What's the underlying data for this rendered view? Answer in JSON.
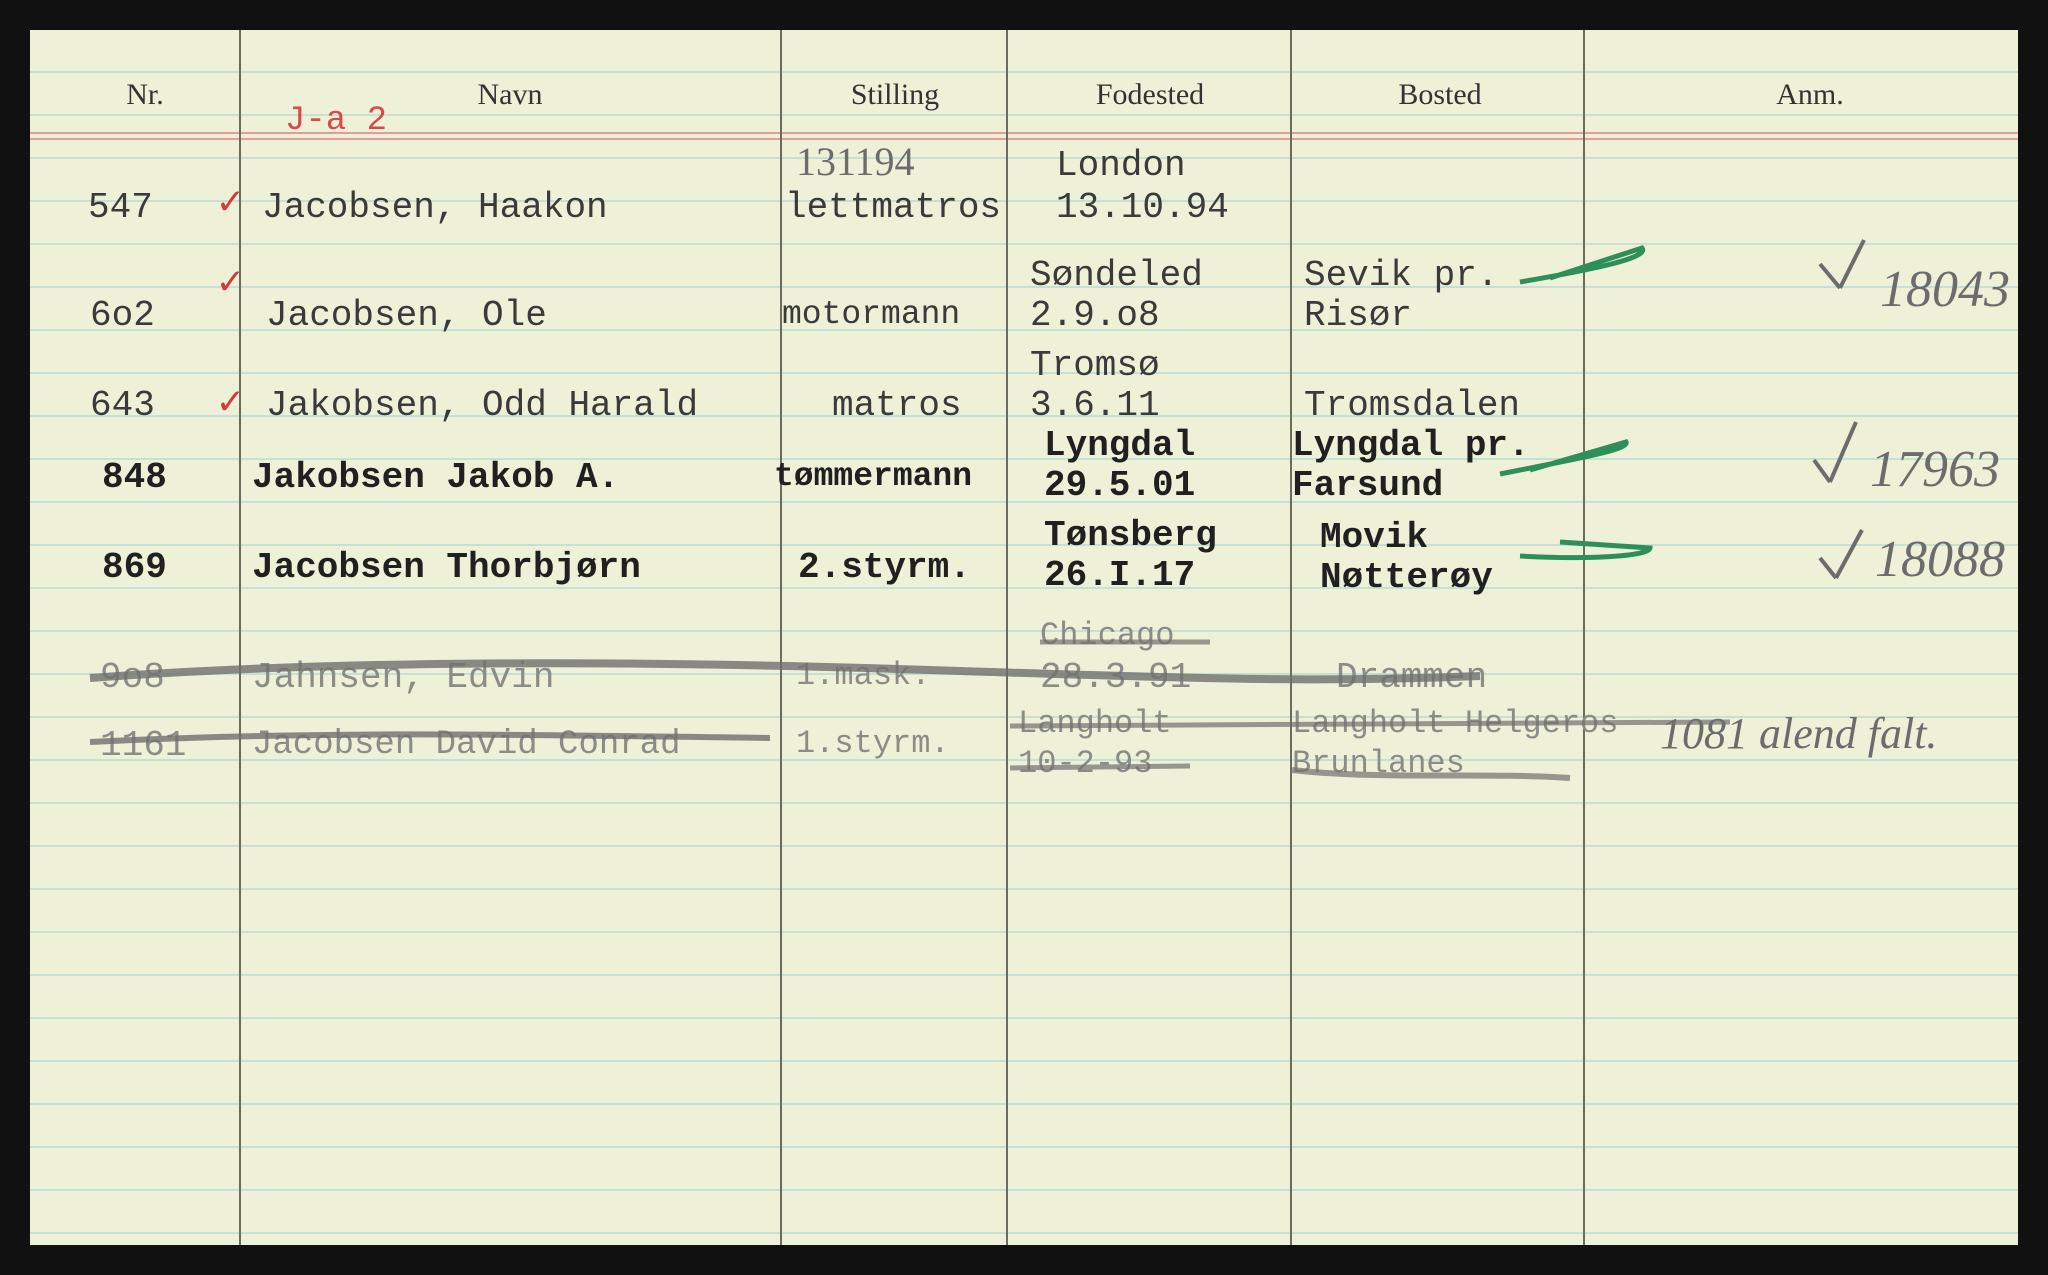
{
  "headers": [
    "Nr.",
    "Navn",
    "Stilling",
    "Fodested",
    "Bosted",
    "Anm."
  ],
  "card_code": "J-a 2",
  "rows": [
    {
      "nr": "547",
      "navn": "Jacobsen, Haakon",
      "stilling": "lettmatros",
      "fodested1": "London",
      "fodested2": "13.10.94",
      "bosted1": "",
      "bosted2": "",
      "note_above": "131194",
      "anm": ""
    },
    {
      "nr": "6o2",
      "navn": "Jacobsen, Ole",
      "stilling": "motormann",
      "fodested1": "Søndeled",
      "fodested2": "2.9.o8",
      "bosted1": "Sevik pr.",
      "bosted2": "Risør",
      "anm": "18043"
    },
    {
      "nr": "643",
      "navn": "Jakobsen, Odd Harald",
      "stilling": "matros",
      "fodested1": "Tromsø",
      "fodested2": "3.6.11",
      "bosted1": "Tromsdalen",
      "bosted2": "",
      "anm": ""
    },
    {
      "nr": "848",
      "navn": "Jakobsen Jakob A.",
      "stilling": "tømmermann",
      "fodested1": "Lyngdal",
      "fodested2": "29.5.01",
      "bosted1": "Lyngdal pr.",
      "bosted2": "Farsund",
      "anm": "17963"
    },
    {
      "nr": "869",
      "navn": "Jacobsen Thorbjørn",
      "stilling": "2.styrm.",
      "fodested1": "Tønsberg",
      "fodested2": "26.I.17",
      "bosted1": "Movik",
      "bosted2": "Nøtterøy",
      "anm": "18088"
    },
    {
      "nr": "9o8",
      "navn": "Jahnsen, Edvin",
      "stilling": "1.mask.",
      "fodested1": "Chicago",
      "fodested2": "28.3.91",
      "bosted1": "Drammen",
      "bosted2": "",
      "anm": ""
    },
    {
      "nr": "1161",
      "navn": "Jacobsen David Conrad",
      "stilling": "1.styrm.",
      "fodested1": "Langholt",
      "fodested2": "10-2-93",
      "bosted1": "Langholt Helgeros",
      "bosted2": "Brunlanes",
      "anm": "1081 alend falt."
    }
  ]
}
